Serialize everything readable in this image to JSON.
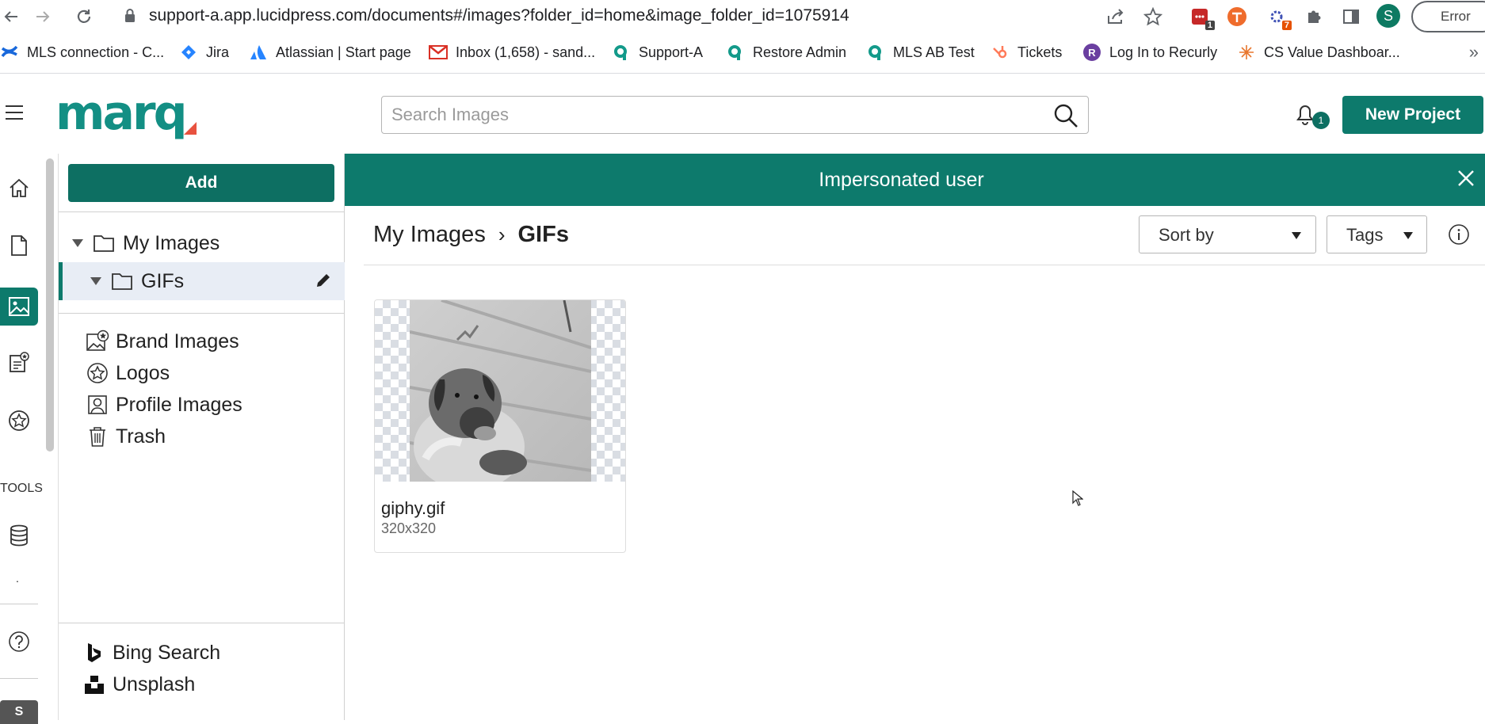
{
  "browser": {
    "url": "support-a.app.lucidpress.com/documents#/images?folder_id=home&image_folder_id=1075914",
    "ext_badge_1": "1",
    "ext_badge_2": "7",
    "profile_initial": "S",
    "error_label": "Error",
    "bookmarks": [
      {
        "label": "MLS connection - C...",
        "icon": "confluence-icon"
      },
      {
        "label": "Jira",
        "icon": "jira-icon"
      },
      {
        "label": "Atlassian | Start page",
        "icon": "atlassian-icon"
      },
      {
        "label": "Inbox (1,658) - sand...",
        "icon": "gmail-icon"
      },
      {
        "label": "Support-A",
        "icon": "marq-q-icon"
      },
      {
        "label": "Restore Admin",
        "icon": "marq-q-icon"
      },
      {
        "label": "MLS AB Test",
        "icon": "marq-q-icon"
      },
      {
        "label": "Tickets",
        "icon": "hubspot-icon"
      },
      {
        "label": "Log In to Recurly",
        "icon": "recurly-icon"
      },
      {
        "label": "CS Value Dashboar...",
        "icon": "tableau-icon"
      }
    ],
    "bookmarks_more": "»"
  },
  "header": {
    "logo_text": "marq",
    "search_placeholder": "Search Images",
    "notification_count": "1",
    "new_project_label": "New Project"
  },
  "rail": {
    "tools_label": "TOOLS",
    "dot": ".",
    "avatar_initial": "S"
  },
  "panel": {
    "add_label": "Add",
    "tree": [
      {
        "label": "My Images"
      },
      {
        "label": "GIFs"
      }
    ],
    "libraries": [
      {
        "label": "Brand Images",
        "icon": "brand-images-icon"
      },
      {
        "label": "Logos",
        "icon": "logos-star-icon"
      },
      {
        "label": "Profile Images",
        "icon": "profile-images-icon"
      },
      {
        "label": "Trash",
        "icon": "trash-icon"
      }
    ],
    "integrations": [
      {
        "label": "Bing Search",
        "icon": "bing-icon"
      },
      {
        "label": "Unsplash",
        "icon": "unsplash-icon"
      }
    ]
  },
  "main": {
    "banner_text": "Impersonated user",
    "breadcrumb": [
      {
        "label": "My Images"
      },
      {
        "label": "GIFs"
      }
    ],
    "breadcrumb_sep": "›",
    "sort_label": "Sort by",
    "tags_label": "Tags",
    "images": [
      {
        "name": "giphy.gif",
        "size": "320x320"
      }
    ]
  },
  "colors": {
    "brand_teal": "#0d7a6c",
    "selected_row": "#e8edf5"
  }
}
